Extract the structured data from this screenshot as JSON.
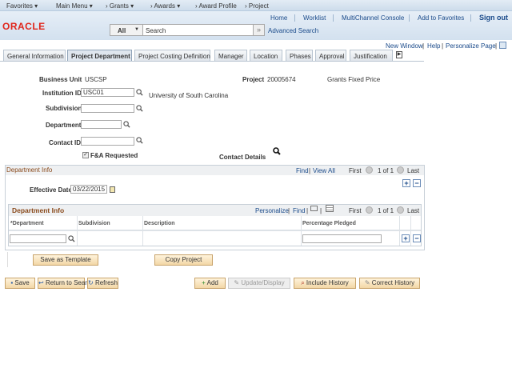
{
  "topnav": {
    "favorites": "Favorites ▾",
    "main_menu": "Main Menu ▾",
    "grants": "›  Grants ▾",
    "awards": "›  Awards ▾",
    "award_profile": "›  Award Profile",
    "project": "›  Project"
  },
  "header": {
    "logo": "ORACLE",
    "home": "Home",
    "worklist": "Worklist",
    "multichannel": "MultiChannel Console",
    "add_favorites": "Add to Favorites",
    "sign_out": "Sign out",
    "search_scope": "All",
    "search_placeholder": "Search",
    "advanced_search": "Advanced Search"
  },
  "page_links": {
    "new_window": "New Window",
    "help": "Help",
    "personalize": "Personalize Page"
  },
  "tabs": [
    {
      "label": "General Information"
    },
    {
      "label": "Project Department"
    },
    {
      "label": "Project Costing Definition"
    },
    {
      "label": "Manager"
    },
    {
      "label": "Location"
    },
    {
      "label": "Phases"
    },
    {
      "label": "Approval"
    },
    {
      "label": "Justification"
    }
  ],
  "form": {
    "business_unit_label": "Business Unit",
    "business_unit": "USCSP",
    "project_label": "Project",
    "project": "20005674",
    "project_desc": "Grants Fixed Price",
    "institution_label": "Institution ID",
    "institution_value": "USC01",
    "institution_desc": "University of South Carolina",
    "subdivision_label": "Subdivision",
    "department_label": "Department",
    "contact_label": "Contact ID",
    "fa_label": "F&A Requested",
    "fa_checked": true,
    "contact_details": "Contact Details"
  },
  "dept_section": {
    "title": "Department Info",
    "find": "Find",
    "view_all": "View All",
    "first": "First",
    "count": "1 of 1",
    "last": "Last",
    "effective_date_label": "Effective Date",
    "effective_date": "03/22/2015"
  },
  "grid": {
    "title": "Department Info",
    "personalize": "Personalize",
    "find": "Find",
    "first": "First",
    "count": "1 of 1",
    "last": "Last",
    "columns": [
      "*Department",
      "Subdivision",
      "Description",
      "Percentage Pledged"
    ]
  },
  "actions": {
    "save_template": "Save as Template",
    "copy_project": "Copy Project"
  },
  "toolbar": {
    "save": "Save",
    "return": "Return to Search",
    "refresh": "Refresh",
    "add": "Add",
    "update": "Update/Display",
    "include": "Include History",
    "correct": "Correct History"
  }
}
